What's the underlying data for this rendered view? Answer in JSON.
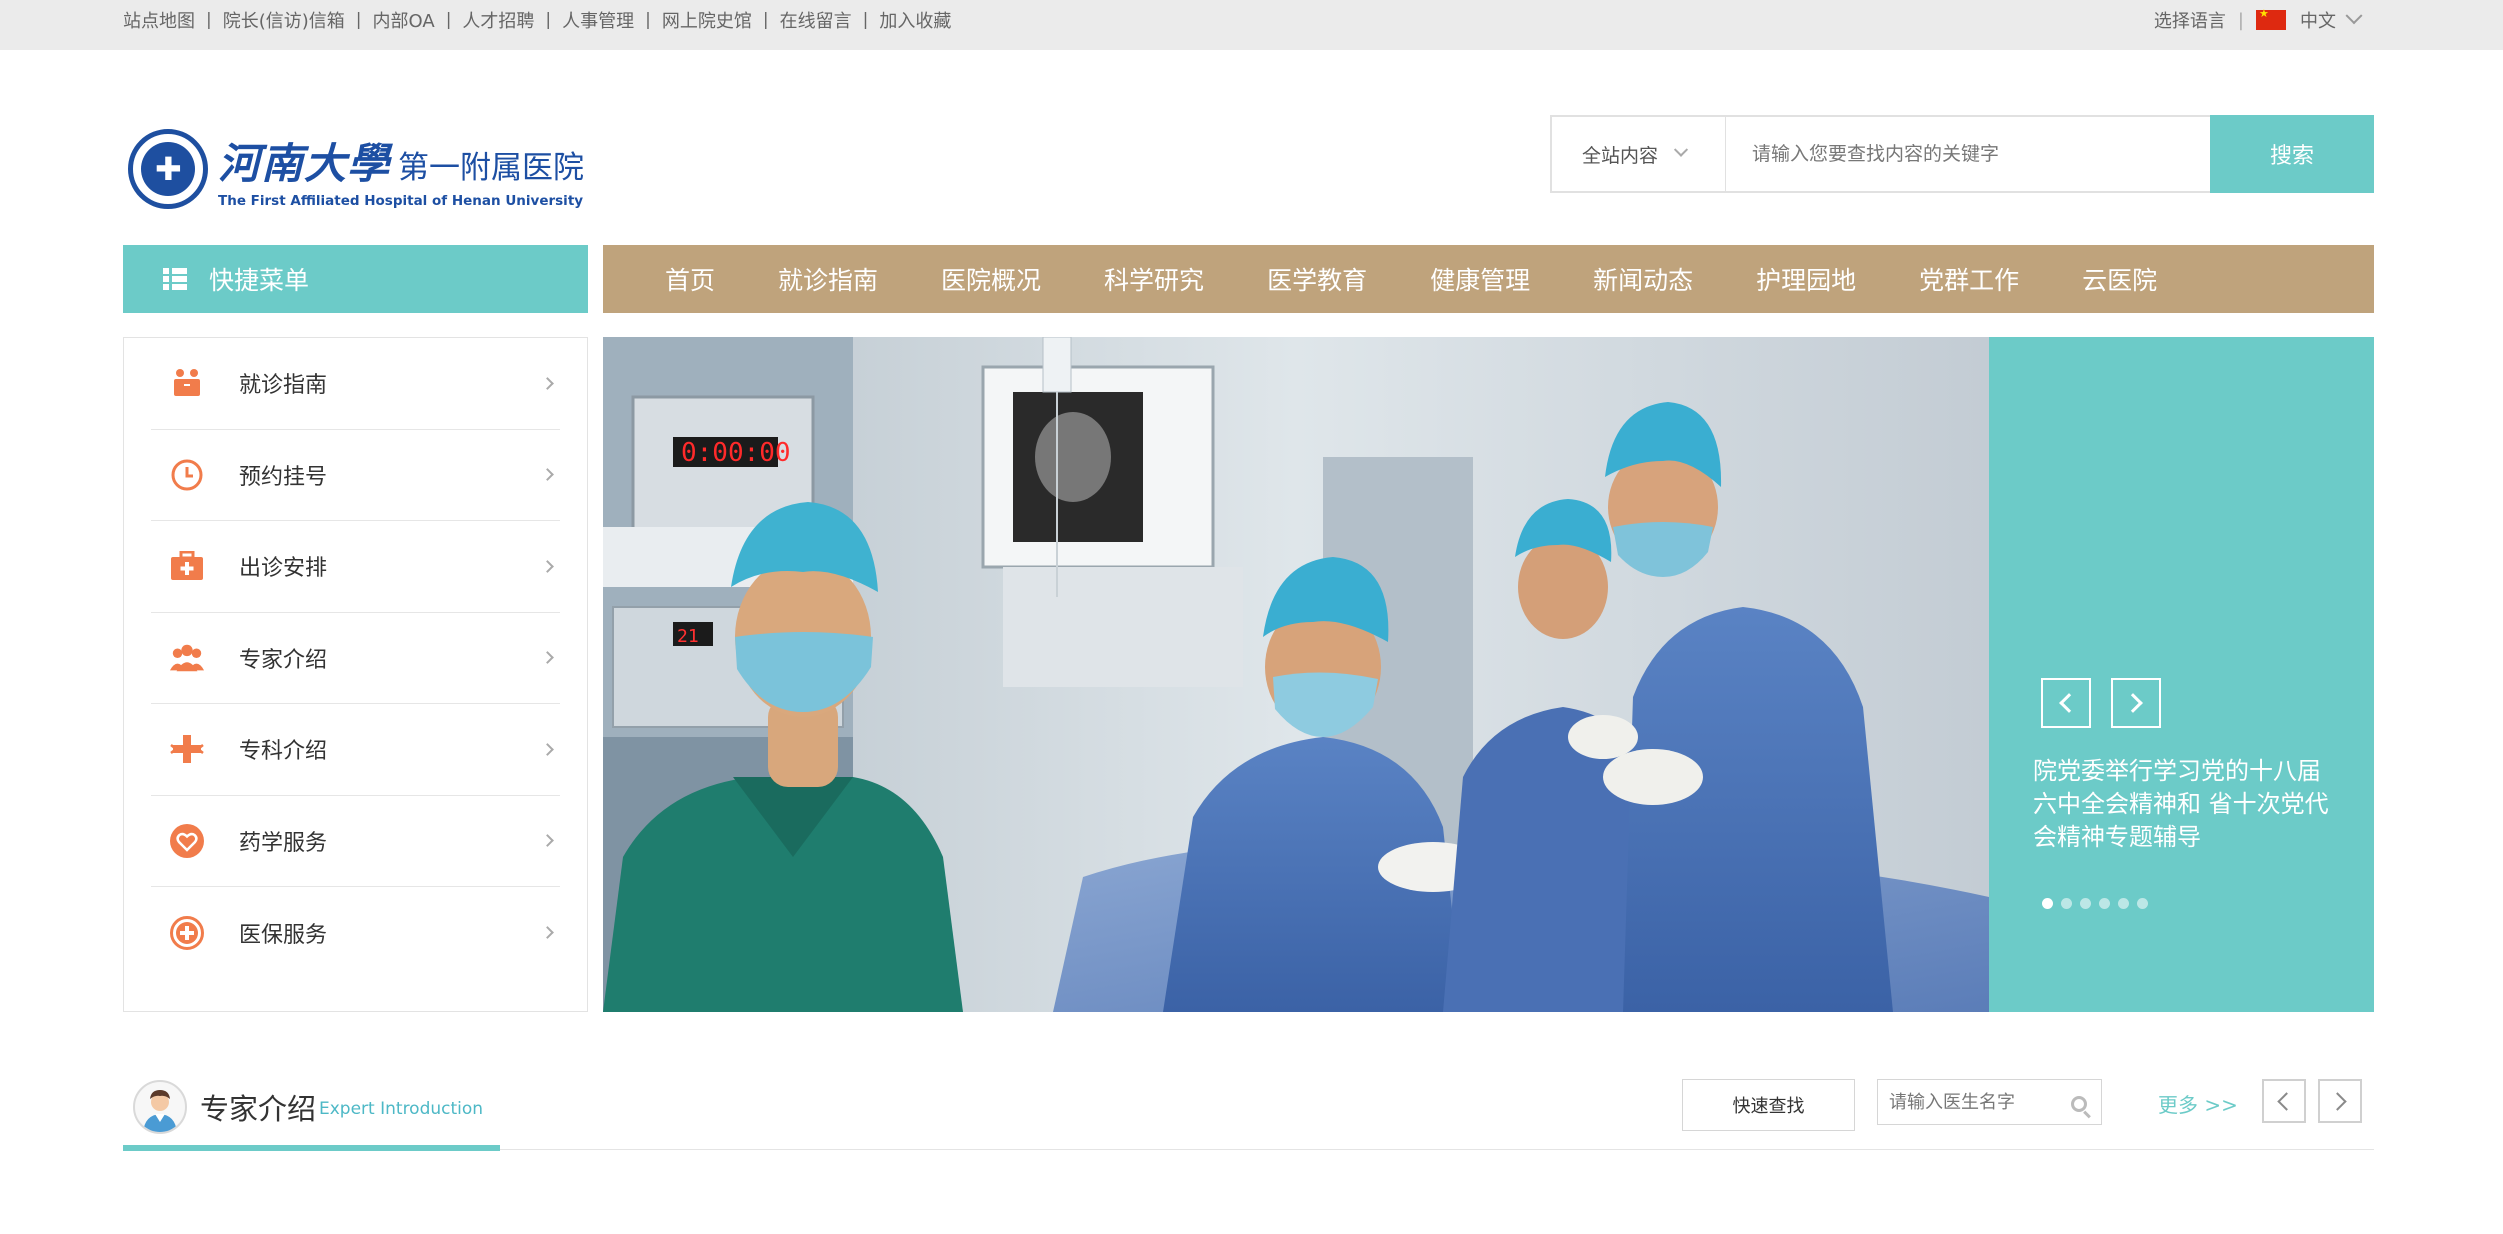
{
  "topbar": {
    "links": [
      "站点地图",
      "院长(信访)信箱",
      "内部OA",
      "人才招聘",
      "人事管理",
      "网上院史馆",
      "在线留言",
      "加入收藏"
    ],
    "language_label": "选择语言",
    "language_value": "中文"
  },
  "logo": {
    "cn_main": "河南大學",
    "cn_sub": "第一附属医院",
    "en": "The First Affiliated Hospital of Henan University"
  },
  "search": {
    "scope": "全站内容",
    "placeholder": "请输入您要查找内容的关键字",
    "button": "搜索"
  },
  "quick_menu": {
    "title": "快捷菜单",
    "items": [
      {
        "label": "就诊指南",
        "icon": "guide-icon"
      },
      {
        "label": "预约挂号",
        "icon": "clock-icon"
      },
      {
        "label": "出诊安排",
        "icon": "medical-kit-icon"
      },
      {
        "label": "专家介绍",
        "icon": "people-icon"
      },
      {
        "label": "专科介绍",
        "icon": "cross-arrows-icon"
      },
      {
        "label": "药学服务",
        "icon": "heart-icon"
      },
      {
        "label": "医保服务",
        "icon": "plus-circle-icon"
      }
    ]
  },
  "nav": {
    "items": [
      "首页",
      "就诊指南",
      "医院概况",
      "科学研究",
      "医学教育",
      "健康管理",
      "新闻动态",
      "护理园地",
      "党群工作",
      "云医院"
    ]
  },
  "banner": {
    "caption": "院党委举行学习党的十八届六中全会精神和 省十次党代会精神专题辅导",
    "slide_count": 6,
    "active_slide": 1,
    "clock_readout": "0:00:00",
    "monitor_readout": "21"
  },
  "experts": {
    "title": "专家介绍",
    "subtitle": "Expert Introduction",
    "quick_find": "快速查找",
    "search_placeholder": "请输入医生名字",
    "more": "更多 >>"
  },
  "colors": {
    "teal": "#6ccbc8",
    "nav_tan": "#bfa37c",
    "icon_orange": "#f17c4b",
    "logo_blue": "#1d4fa3"
  }
}
